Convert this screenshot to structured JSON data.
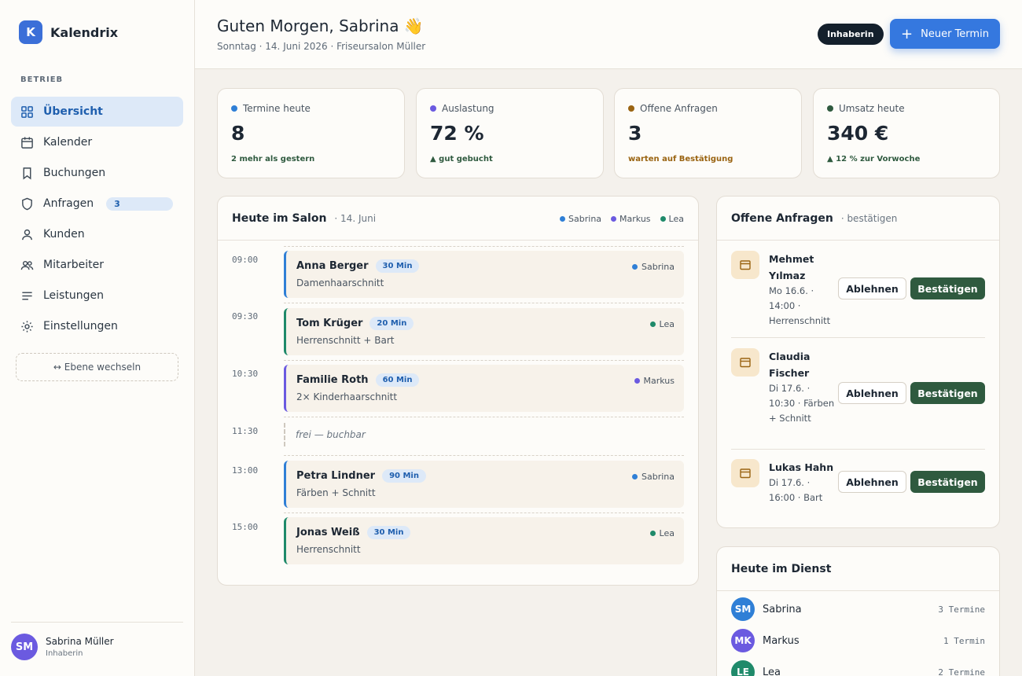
{
  "brand": {
    "logo_letter": "K",
    "name": "Kalendrix"
  },
  "sidebar": {
    "section_label": "BETRIEB",
    "items": [
      {
        "label": "Übersicht",
        "icon": "grid-icon",
        "active": true
      },
      {
        "label": "Kalender",
        "icon": "calendar-icon"
      },
      {
        "label": "Buchungen",
        "icon": "bookmark-icon"
      },
      {
        "label": "Anfragen",
        "icon": "shield-icon",
        "badge": "3"
      },
      {
        "label": "Kunden",
        "icon": "user-icon"
      },
      {
        "label": "Mitarbeiter",
        "icon": "users-icon"
      },
      {
        "label": "Leistungen",
        "icon": "list-icon"
      },
      {
        "label": "Einstellungen",
        "icon": "gear-icon"
      }
    ],
    "switch_label": "↔ Ebene wechseln",
    "user": {
      "initials": "SM",
      "name": "Sabrina Müller",
      "role": "Inhaberin"
    }
  },
  "header": {
    "greeting": "Guten Morgen, Sabrina 👋",
    "subline": "Sonntag · 14. Juni 2026 · Friseursalon Müller",
    "role_pill": "Inhaberin",
    "new_button": "Neuer Termin"
  },
  "kpis": [
    {
      "label": "Termine heute",
      "value": "8",
      "note": "2 mehr als gestern",
      "dot_color": "#2f7fd6",
      "note_color": "#2f5a3f"
    },
    {
      "label": "Auslastung",
      "value": "72 %",
      "note": "▲ gut gebucht",
      "dot_color": "#6b5ae0",
      "note_color": "#2f5a3f"
    },
    {
      "label": "Offene Anfragen",
      "value": "3",
      "note": "warten auf Bestätigung",
      "dot_color": "#9a6412",
      "note_color": "#9a6412"
    },
    {
      "label": "Umsatz heute",
      "value": "340 €",
      "note": "▲ 12 % zur Vorwoche",
      "dot_color": "#2f5a3f",
      "note_color": "#2f5a3f"
    }
  ],
  "schedule": {
    "title": "Heute im Salon",
    "date": "· 14. Juni",
    "legend": [
      {
        "name": "Sabrina",
        "color": "#2f7fd6"
      },
      {
        "name": "Markus",
        "color": "#6b5ae0"
      },
      {
        "name": "Lea",
        "color": "#1f8a6a"
      }
    ],
    "appointments": [
      {
        "time": "09:00",
        "name": "Anna Berger",
        "duration": "30 Min",
        "service": "Damenhaarschnitt",
        "staff": "Sabrina",
        "color": "#2f7fd6"
      },
      {
        "time": "09:30",
        "name": "Tom Krüger",
        "duration": "20 Min",
        "service": "Herrenschnitt + Bart",
        "staff": "Lea",
        "color": "#1f8a6a"
      },
      {
        "time": "10:30",
        "name": "Familie Roth",
        "duration": "60 Min",
        "service": "2× Kinderhaarschnitt",
        "staff": "Markus",
        "color": "#6b5ae0"
      },
      {
        "time": "11:30",
        "free_label": "frei — buchbar"
      },
      {
        "time": "13:00",
        "name": "Petra Lindner",
        "duration": "90 Min",
        "service": "Färben + Schnitt",
        "staff": "Sabrina",
        "color": "#2f7fd6"
      },
      {
        "time": "15:00",
        "name": "Jonas Weiß",
        "duration": "30 Min",
        "service": "Herrenschnitt",
        "staff": "Lea",
        "color": "#1f8a6a"
      }
    ]
  },
  "requests": {
    "title": "Offene Anfragen",
    "subtitle": "· bestätigen",
    "reject_label": "Ablehnen",
    "accept_label": "Bestätigen",
    "items": [
      {
        "name": "Mehmet Yılmaz",
        "meta": "Mo 16.6. · 14:00 · Herrenschnitt"
      },
      {
        "name": "Claudia Fischer",
        "meta": "Di 17.6. · 10:30 · Färben + Schnitt"
      },
      {
        "name": "Lukas Hahn",
        "meta": "Di 17.6. · 16:00 · Bart"
      }
    ]
  },
  "duty": {
    "title": "Heute im Dienst",
    "staff": [
      {
        "initials": "SM",
        "name": "Sabrina",
        "count": "3 Termine",
        "color": "#2f7fd6"
      },
      {
        "initials": "MK",
        "name": "Markus",
        "count": "1 Termin",
        "color": "#6b5ae0"
      },
      {
        "initials": "LE",
        "name": "Lea",
        "count": "2 Termine",
        "color": "#1f8a6a"
      }
    ]
  }
}
